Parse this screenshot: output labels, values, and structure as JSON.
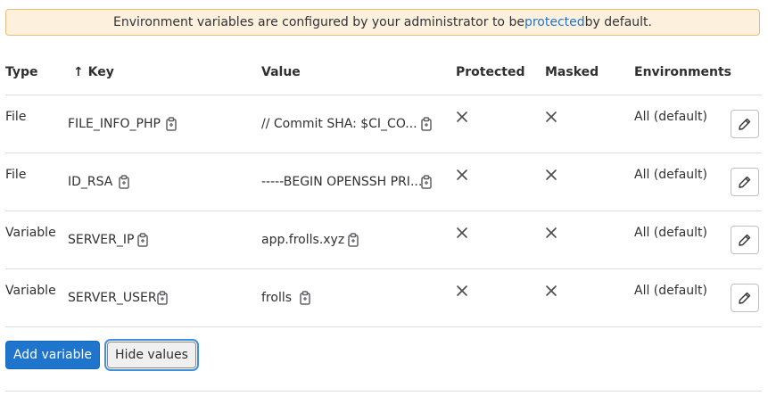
{
  "banner": {
    "text_before": "Environment variables are configured by your administrator to be ",
    "link": "protected",
    "text_after": " by default."
  },
  "table": {
    "headers": {
      "type": "Type",
      "key": "Key",
      "value": "Value",
      "protected": "Protected",
      "masked": "Masked",
      "environments": "Environments"
    },
    "sort_indicator": "↑",
    "rows": [
      {
        "type": "File",
        "key": "FILE_INFO_PHP",
        "value": "// Commit SHA: $CI_CO...",
        "protected": false,
        "masked": false,
        "environment": "All (default)"
      },
      {
        "type": "File",
        "key": "ID_RSA",
        "value": "-----BEGIN OPENSSH PRI...",
        "protected": false,
        "masked": false,
        "environment": "All (default)"
      },
      {
        "type": "Variable",
        "key": "SERVER_IP",
        "value": "app.frolls.xyz",
        "protected": false,
        "masked": false,
        "environment": "All (default)"
      },
      {
        "type": "Variable",
        "key": "SERVER_USER",
        "value": "frolls",
        "protected": false,
        "masked": false,
        "environment": "All (default)"
      }
    ]
  },
  "actions": {
    "add_variable": "Add variable",
    "hide_values": "Hide values"
  },
  "colors": {
    "primary": "#1f75cb",
    "banner_bg": "#fdf1dd",
    "banner_border": "#e9be74",
    "link": "#1f75cb"
  }
}
